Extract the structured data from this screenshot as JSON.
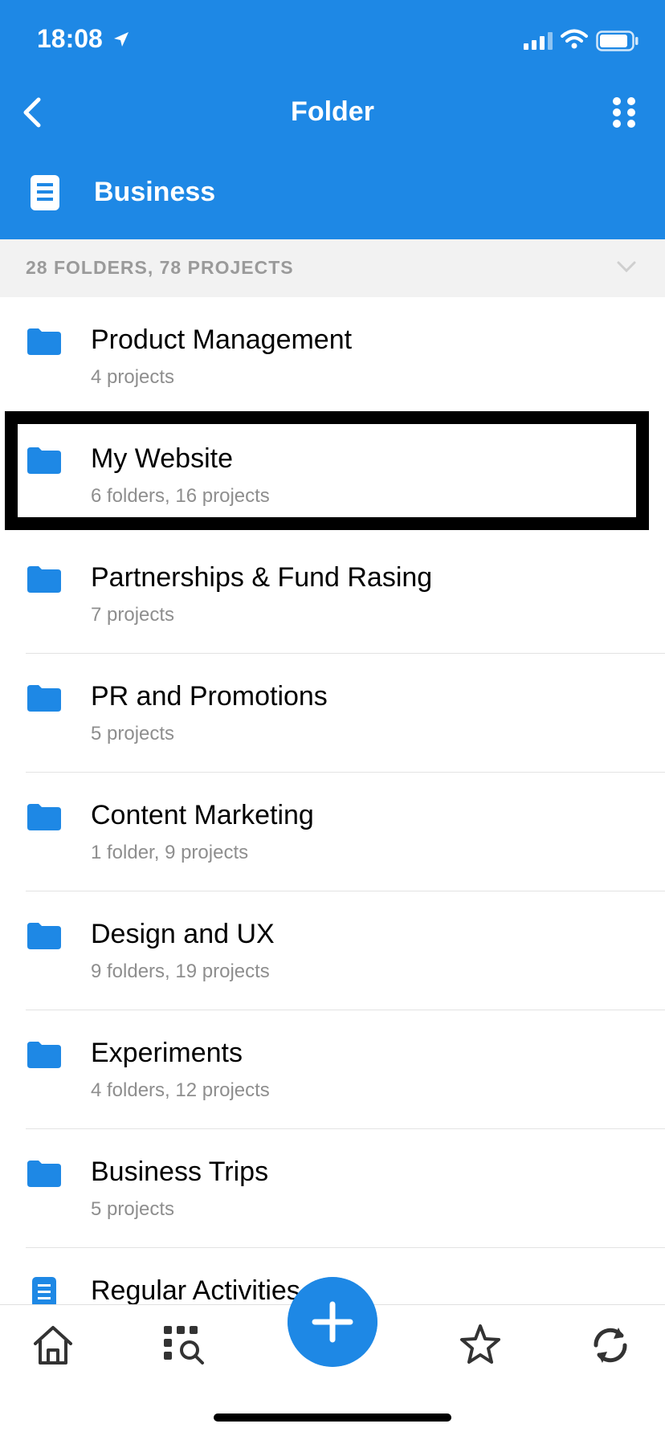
{
  "status_bar": {
    "time": "18:08"
  },
  "nav": {
    "title": "Folder"
  },
  "folder": {
    "name": "Business"
  },
  "summary": {
    "text": "28 FOLDERS, 78 PROJECTS"
  },
  "items": [
    {
      "title": "Product Management",
      "subtitle": "4 projects",
      "icon": "folder-icon"
    },
    {
      "title": "My Website",
      "subtitle": "6 folders, 16 projects",
      "icon": "folder-icon"
    },
    {
      "title": "Partnerships & Fund Rasing",
      "subtitle": "7 projects",
      "icon": "folder-icon"
    },
    {
      "title": "PR and Promotions",
      "subtitle": "5 projects",
      "icon": "folder-icon"
    },
    {
      "title": "Content Marketing",
      "subtitle": "1 folder, 9 projects",
      "icon": "folder-icon"
    },
    {
      "title": "Design and UX",
      "subtitle": "9 folders, 19 projects",
      "icon": "folder-icon"
    },
    {
      "title": "Experiments",
      "subtitle": "4 folders, 12 projects",
      "icon": "folder-icon"
    },
    {
      "title": "Business Trips",
      "subtitle": "5 projects",
      "icon": "folder-icon"
    },
    {
      "title": "Regular Activities",
      "subtitle": "",
      "icon": "document-icon"
    }
  ],
  "tabbar": {
    "tabs": [
      "home-icon",
      "search-grid-icon",
      "add-icon",
      "star-icon",
      "sync-icon"
    ]
  },
  "colors": {
    "accent": "#1e88e5"
  }
}
